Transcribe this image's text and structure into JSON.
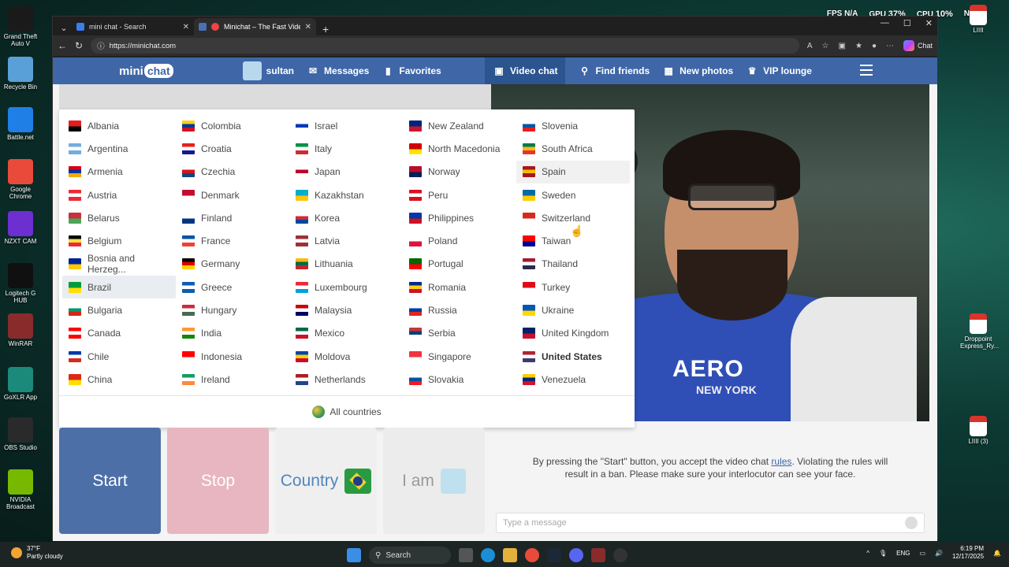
{
  "hud": {
    "fps_label": "FPS",
    "fps_value": "N/A",
    "gpu_label": "GPU",
    "gpu_value": "37%",
    "cpu_label": "CPU",
    "cpu_value": "10%",
    "extra": "N/A"
  },
  "desktop_icons": [
    {
      "label": "Grand Theft Auto V",
      "color": "#1a1a1a"
    },
    {
      "label": "Recycle Bin",
      "color": "#5aa0d8"
    },
    {
      "label": "Battle.net",
      "color": "#1f7fe6"
    },
    {
      "label": "Google Chrome",
      "color": "#e84b3a"
    },
    {
      "label": "NZXT CAM",
      "color": "#6d2fd0"
    },
    {
      "label": "Logitech G HUB",
      "color": "#101010"
    },
    {
      "label": "WinRAR",
      "color": "#8a2b2b"
    },
    {
      "label": "GoXLR App",
      "color": "#1c8a7a"
    },
    {
      "label": "OBS Studio",
      "color": "#2a2a2a"
    },
    {
      "label": "NVIDIA Broadcast",
      "color": "#76b900"
    }
  ],
  "right_icons": [
    {
      "label": "Droppoint Express_Ry..."
    },
    {
      "label": "LIIII (3)"
    },
    {
      "label": "LIIII"
    }
  ],
  "browser": {
    "tabs": [
      {
        "title": "mini chat - Search",
        "active": false
      },
      {
        "title": "Minichat – The Fast Video Cha",
        "active": true
      }
    ],
    "url": "https://minichat.com",
    "copilot_label": "Chat"
  },
  "site": {
    "logo_a": "mini",
    "logo_b": "chat",
    "nav": {
      "user": "sultan",
      "messages": "Messages",
      "favorites": "Favorites",
      "video_chat": "Video chat",
      "find_friends": "Find friends",
      "new_photos": "New photos",
      "vip_lounge": "VIP lounge"
    },
    "countries": [
      [
        "Albania",
        "Colombia",
        "Israel",
        "New Zealand",
        "Slovenia"
      ],
      [
        "Argentina",
        "Croatia",
        "Italy",
        "North Macedonia",
        "South Africa"
      ],
      [
        "Armenia",
        "Czechia",
        "Japan",
        "Norway",
        "Spain"
      ],
      [
        "Austria",
        "Denmark",
        "Kazakhstan",
        "Peru",
        "Sweden"
      ],
      [
        "Belarus",
        "Finland",
        "Korea",
        "Philippines",
        "Switzerland"
      ],
      [
        "Belgium",
        "France",
        "Latvia",
        "Poland",
        "Taiwan"
      ],
      [
        "Bosnia and Herzeg...",
        "Germany",
        "Lithuania",
        "Portugal",
        "Thailand"
      ],
      [
        "Brazil",
        "Greece",
        "Luxembourg",
        "Romania",
        "Turkey"
      ],
      [
        "Bulgaria",
        "Hungary",
        "Malaysia",
        "Russia",
        "Ukraine"
      ],
      [
        "Canada",
        "India",
        "Mexico",
        "Serbia",
        "United Kingdom"
      ],
      [
        "Chile",
        "Indonesia",
        "Moldova",
        "Singapore",
        "United States"
      ],
      [
        "China",
        "Ireland",
        "Netherlands",
        "Slovakia",
        "Venezuela"
      ]
    ],
    "selected_country": "Brazil",
    "hovered_country": "Spain",
    "bold_country": "United States",
    "all_countries": "All countries",
    "buttons": {
      "start": "Start",
      "stop": "Stop",
      "country": "Country",
      "iam": "I am"
    },
    "info_pre": "By pressing the \"Start\" button, you accept the video chat ",
    "info_link": "rules",
    "info_post": ". Violating the rules will result in a ban. Please make sure your interlocutor can see your face.",
    "message_placeholder": "Type a message",
    "shirt_text": "AERO",
    "shirt_sub": "NEW YORK",
    "colors": {
      "brand": "#3f67a7",
      "start": "#4d6fa8",
      "stop": "#e8b6c0"
    }
  },
  "taskbar": {
    "temp": "37°F",
    "weather": "Partly cloudy",
    "search": "Search",
    "lang": "ENG",
    "time": "6:19 PM",
    "date": "12/17/2025"
  }
}
